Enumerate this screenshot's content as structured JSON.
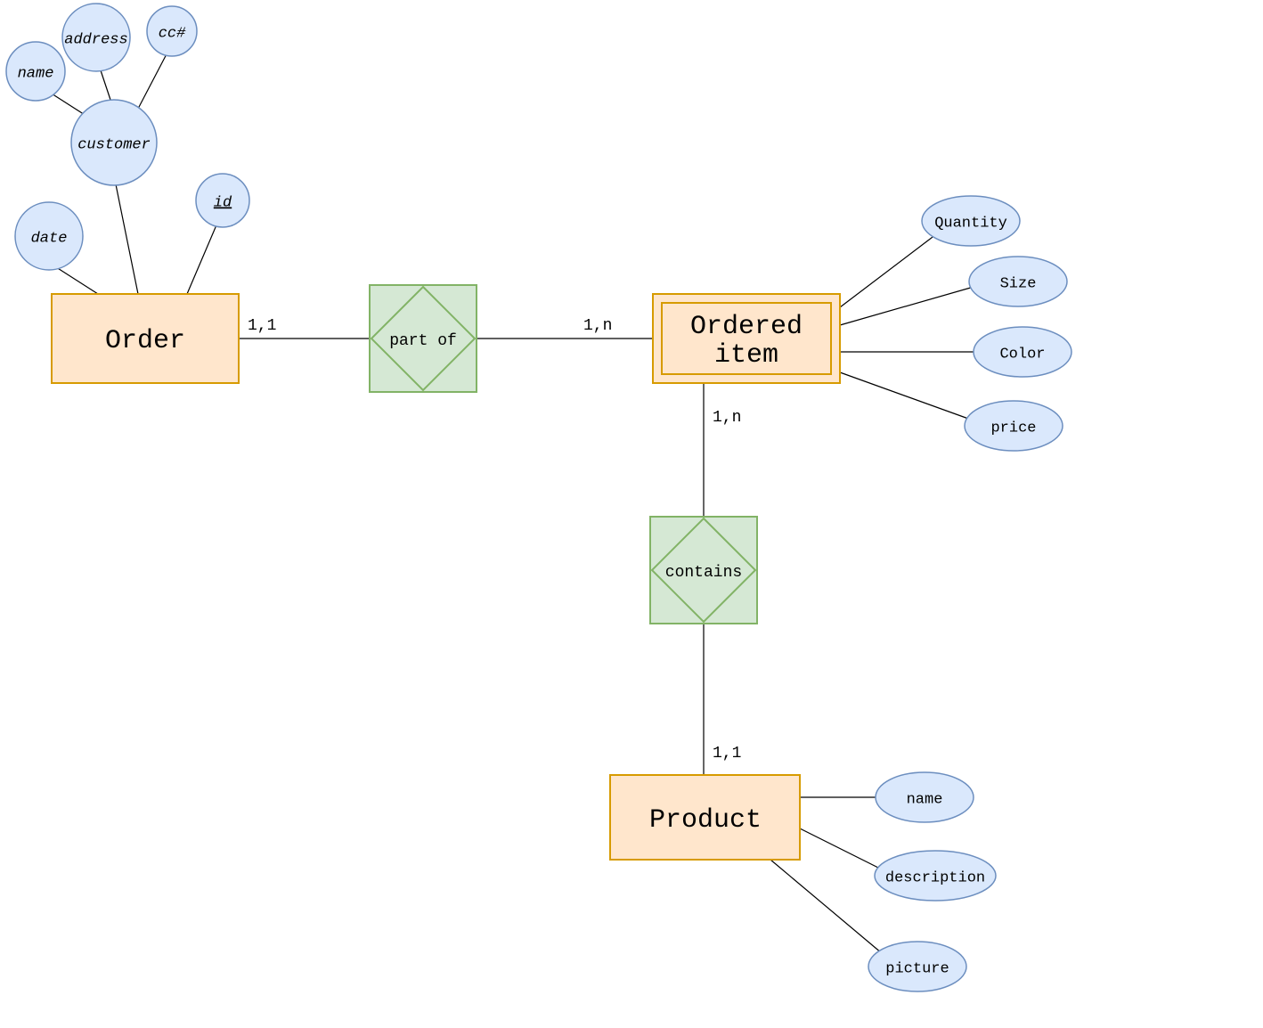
{
  "entities": {
    "order": "Order",
    "ordered_item_l1": "Ordered",
    "ordered_item_l2": "item",
    "product": "Product"
  },
  "relationships": {
    "part_of": "part of",
    "contains": "contains"
  },
  "attributes": {
    "name": "name",
    "address": "address",
    "ccnum": "cc#",
    "customer": "customer",
    "date": "date",
    "id": "id",
    "quantity": "Quantity",
    "size": "Size",
    "color": "Color",
    "price": "price",
    "prod_name": "name",
    "description": "description",
    "picture": "picture"
  },
  "cardinalities": {
    "order_partof": "1,1",
    "partof_ordered": "1,n",
    "ordered_contains": "1,n",
    "contains_product": "1,1"
  }
}
